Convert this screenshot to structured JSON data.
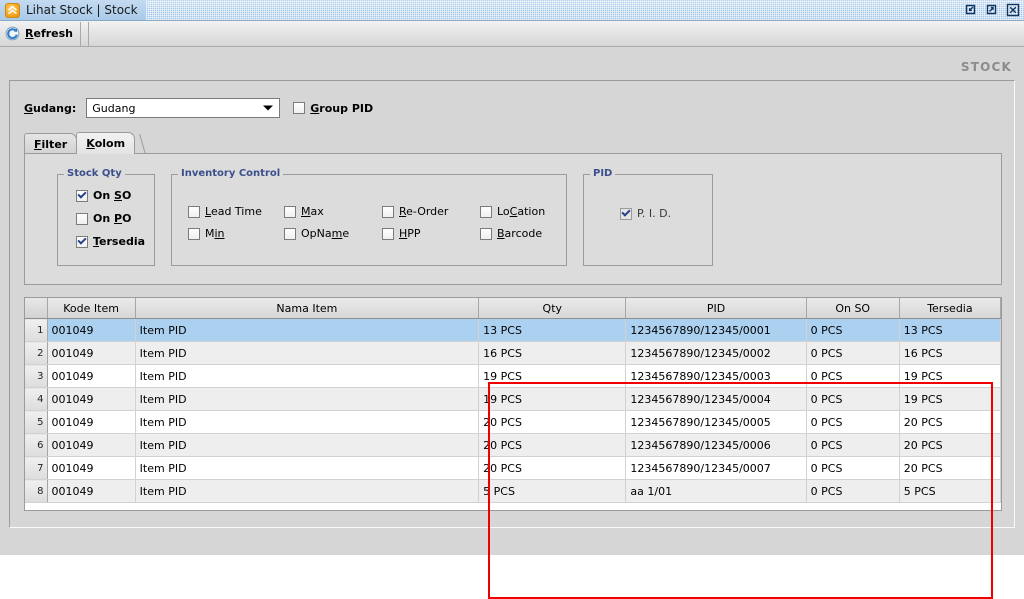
{
  "window": {
    "title": "Lihat Stock | Stock",
    "app_icon": "chevrons-up-icon",
    "buttons": {
      "minimize": "minimize-icon",
      "maximize": "maximize-icon",
      "close": "close-icon"
    }
  },
  "toolbar": {
    "refresh_icon": "refresh-icon",
    "refresh_label_mnemonic": "R",
    "refresh_label_rest": "efresh"
  },
  "caption": "STOCK",
  "gudang": {
    "label": "Gudang:",
    "combo_value": "Gudang",
    "combo_arrow": "chevron-down-icon",
    "group_pid": {
      "mnemonic": "G",
      "rest": "roup PID",
      "checked": false
    }
  },
  "tabs": [
    {
      "mnemonic": "F",
      "rest": "ilter",
      "active": false
    },
    {
      "mnemonic": "K",
      "rest": "olom",
      "active": true
    }
  ],
  "groups": {
    "stock_qty": {
      "title": "Stock Qty",
      "items": [
        {
          "pre": "On ",
          "mnemonic": "S",
          "post": "O",
          "checked": true
        },
        {
          "pre": "On ",
          "mnemonic": "P",
          "post": "O",
          "checked": false
        },
        {
          "pre": "",
          "mnemonic": "T",
          "post": "ersedia",
          "checked": true
        }
      ]
    },
    "inventory_control": {
      "title": "Inventory Control",
      "items": [
        {
          "pre": "",
          "mnemonic": "L",
          "post": "ead Time",
          "checked": false
        },
        {
          "pre": "",
          "mnemonic": "M",
          "post": "ax",
          "checked": false
        },
        {
          "pre": "",
          "mnemonic": "R",
          "post": "e-Order",
          "checked": false
        },
        {
          "pre": "Lo",
          "mnemonic": "C",
          "post": "ation",
          "checked": false
        },
        {
          "pre": "",
          "mnemonic": "M",
          "post": "in",
          "checked": false
        },
        {
          "pre": "OpNa",
          "mnemonic": "m",
          "post": "e",
          "checked": false
        },
        {
          "pre": "",
          "mnemonic": "H",
          "post": "PP",
          "checked": false
        },
        {
          "pre": "",
          "mnemonic": "B",
          "post": "arcode",
          "checked": false
        }
      ]
    },
    "pid": {
      "title": "PID",
      "item": {
        "label": "P. I. D.",
        "checked": true,
        "disabled": true
      }
    }
  },
  "table": {
    "columns": [
      "",
      "Kode Item",
      "Nama Item",
      "Qty",
      "PID",
      "On SO",
      "Tersedia"
    ],
    "rows": [
      {
        "n": "1",
        "kode": "001049",
        "nama": "Item PID",
        "qty": "13 PCS",
        "pid": "1234567890/12345/0001",
        "onso": "0 PCS",
        "tersedia": "13 PCS",
        "selected": true
      },
      {
        "n": "2",
        "kode": "001049",
        "nama": "Item PID",
        "qty": "16 PCS",
        "pid": "1234567890/12345/0002",
        "onso": "0 PCS",
        "tersedia": "16 PCS",
        "selected": false
      },
      {
        "n": "3",
        "kode": "001049",
        "nama": "Item PID",
        "qty": "19 PCS",
        "pid": "1234567890/12345/0003",
        "onso": "0 PCS",
        "tersedia": "19 PCS",
        "selected": false
      },
      {
        "n": "4",
        "kode": "001049",
        "nama": "Item PID",
        "qty": "19 PCS",
        "pid": "1234567890/12345/0004",
        "onso": "0 PCS",
        "tersedia": "19 PCS",
        "selected": false
      },
      {
        "n": "5",
        "kode": "001049",
        "nama": "Item PID",
        "qty": "20 PCS",
        "pid": "1234567890/12345/0005",
        "onso": "0 PCS",
        "tersedia": "20 PCS",
        "selected": false
      },
      {
        "n": "6",
        "kode": "001049",
        "nama": "Item PID",
        "qty": "20 PCS",
        "pid": "1234567890/12345/0006",
        "onso": "0 PCS",
        "tersedia": "20 PCS",
        "selected": false
      },
      {
        "n": "7",
        "kode": "001049",
        "nama": "Item PID",
        "qty": "20 PCS",
        "pid": "1234567890/12345/0007",
        "onso": "0 PCS",
        "tersedia": "20 PCS",
        "selected": false
      },
      {
        "n": "8",
        "kode": "001049",
        "nama": "Item PID",
        "qty": "5 PCS",
        "pid": "aa 1/01",
        "onso": "0 PCS",
        "tersedia": "5 PCS",
        "selected": false
      }
    ]
  },
  "colors": {
    "qty_text": "#3333cc",
    "highlight_box": "#ee0000",
    "selected_row": "#abd0f0",
    "group_title": "#3b4f8c",
    "caption": "#8c8c8c"
  }
}
